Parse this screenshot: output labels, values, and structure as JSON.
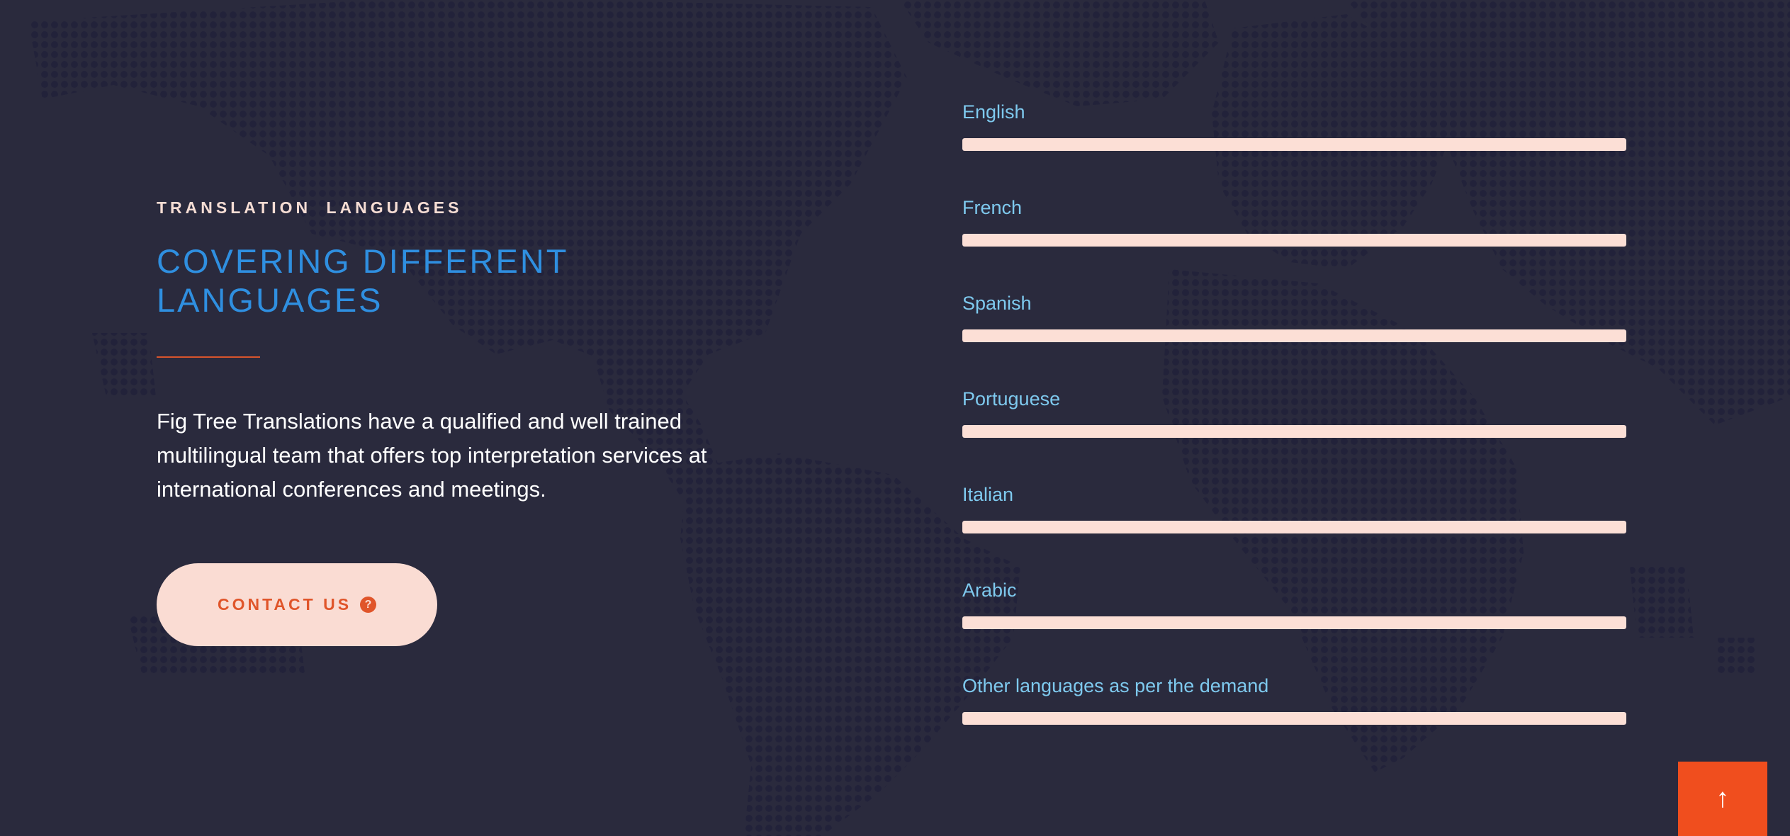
{
  "section": {
    "eyebrow": "TRANSLATION LANGUAGES",
    "heading": "COVERING DIFFERENT LANGUAGES",
    "description": "Fig Tree Translations have a qualified and well trained multilingual team that offers top interpretation services at international conferences and meetings.",
    "contact_button": {
      "label": "CONTACT US",
      "icon": "question-circle-icon",
      "icon_glyph": "?"
    }
  },
  "languages": [
    {
      "label": "English",
      "progress": 1.0
    },
    {
      "label": "French",
      "progress": 1.0
    },
    {
      "label": "Spanish",
      "progress": 1.0
    },
    {
      "label": "Portuguese",
      "progress": 1.0
    },
    {
      "label": "Italian",
      "progress": 1.0
    },
    {
      "label": "Arabic",
      "progress": 1.0
    },
    {
      "label": "Other languages as per the demand",
      "progress": 1.0
    }
  ],
  "scroll_top": {
    "icon": "arrow-up-icon",
    "glyph": "↑"
  },
  "colors": {
    "background": "#2a2a3d",
    "map_dots": "#22223a",
    "accent_orange": "#f04e1e",
    "heading_blue": "#2f8fe0",
    "label_blue": "#7ec9ee",
    "bar_fill": "#fcdfd6",
    "button_bg": "#fadcd3"
  }
}
